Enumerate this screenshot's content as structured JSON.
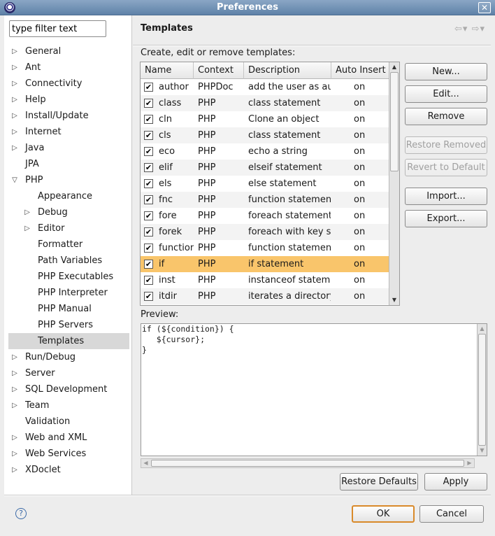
{
  "window": {
    "title": "Preferences",
    "close_glyph": "✕"
  },
  "filter": {
    "value": "type filter text"
  },
  "tree": [
    {
      "label": "General",
      "expander": "▷",
      "level": 0
    },
    {
      "label": "Ant",
      "expander": "▷",
      "level": 0
    },
    {
      "label": "Connectivity",
      "expander": "▷",
      "level": 0
    },
    {
      "label": "Help",
      "expander": "▷",
      "level": 0
    },
    {
      "label": "Install/Update",
      "expander": "▷",
      "level": 0
    },
    {
      "label": "Internet",
      "expander": "▷",
      "level": 0
    },
    {
      "label": "Java",
      "expander": "▷",
      "level": 0
    },
    {
      "label": "JPA",
      "expander": "",
      "level": 0
    },
    {
      "label": "PHP",
      "expander": "▽",
      "level": 0
    },
    {
      "label": "Appearance",
      "expander": "",
      "level": 1
    },
    {
      "label": "Debug",
      "expander": "▷",
      "level": 1
    },
    {
      "label": "Editor",
      "expander": "▷",
      "level": 1
    },
    {
      "label": "Formatter",
      "expander": "",
      "level": 1
    },
    {
      "label": "Path Variables",
      "expander": "",
      "level": 1
    },
    {
      "label": "PHP Executables",
      "expander": "",
      "level": 1
    },
    {
      "label": "PHP Interpreter",
      "expander": "",
      "level": 1
    },
    {
      "label": "PHP Manual",
      "expander": "",
      "level": 1
    },
    {
      "label": "PHP Servers",
      "expander": "",
      "level": 1
    },
    {
      "label": "Templates",
      "expander": "",
      "level": 1,
      "selected": true
    },
    {
      "label": "Run/Debug",
      "expander": "▷",
      "level": 0
    },
    {
      "label": "Server",
      "expander": "▷",
      "level": 0
    },
    {
      "label": "SQL Development",
      "expander": "▷",
      "level": 0
    },
    {
      "label": "Team",
      "expander": "▷",
      "level": 0
    },
    {
      "label": "Validation",
      "expander": "",
      "level": 0
    },
    {
      "label": "Web and XML",
      "expander": "▷",
      "level": 0
    },
    {
      "label": "Web Services",
      "expander": "▷",
      "level": 0
    },
    {
      "label": "XDoclet",
      "expander": "▷",
      "level": 0
    }
  ],
  "page": {
    "title": "Templates",
    "nav": "⇦▾ ⇨▾",
    "description": "Create, edit or remove templates:",
    "preview_label": "Preview:"
  },
  "table": {
    "columns": [
      "Name",
      "Context",
      "Description",
      "Auto Insert"
    ],
    "rows": [
      {
        "checked": true,
        "name": "author",
        "context": "PHPDoc",
        "description": "add the user as author",
        "auto": "on"
      },
      {
        "checked": true,
        "name": "class",
        "context": "PHP",
        "description": "class statement",
        "auto": "on"
      },
      {
        "checked": true,
        "name": "cln",
        "context": "PHP",
        "description": "Clone an object",
        "auto": "on"
      },
      {
        "checked": true,
        "name": "cls",
        "context": "PHP",
        "description": "class statement",
        "auto": "on"
      },
      {
        "checked": true,
        "name": "eco",
        "context": "PHP",
        "description": "echo a string",
        "auto": "on"
      },
      {
        "checked": true,
        "name": "elif",
        "context": "PHP",
        "description": "elseif statement",
        "auto": "on"
      },
      {
        "checked": true,
        "name": "els",
        "context": "PHP",
        "description": "else statement",
        "auto": "on"
      },
      {
        "checked": true,
        "name": "fnc",
        "context": "PHP",
        "description": "function statement",
        "auto": "on"
      },
      {
        "checked": true,
        "name": "fore",
        "context": "PHP",
        "description": "foreach statement",
        "auto": "on"
      },
      {
        "checked": true,
        "name": "forek",
        "context": "PHP",
        "description": "foreach with key statement",
        "auto": "on"
      },
      {
        "checked": true,
        "name": "function",
        "context": "PHP",
        "description": "function statement",
        "auto": "on"
      },
      {
        "checked": true,
        "name": "if",
        "context": "PHP",
        "description": "if statement",
        "auto": "on",
        "selected": true
      },
      {
        "checked": true,
        "name": "inst",
        "context": "PHP",
        "description": "instanceof statement",
        "auto": "on"
      },
      {
        "checked": true,
        "name": "itdir",
        "context": "PHP",
        "description": "iterates a directory",
        "auto": "on"
      }
    ]
  },
  "buttons": {
    "new": "New...",
    "edit": "Edit...",
    "remove": "Remove",
    "restore_removed": "Restore Removed",
    "revert_default": "Revert to Default",
    "import": "Import...",
    "export": "Export...",
    "restore_defaults": "Restore Defaults",
    "apply": "Apply",
    "ok": "OK",
    "cancel": "Cancel"
  },
  "preview": {
    "code": "if (${condition}) {\n   ${cursor};\n}"
  },
  "icons": {
    "help": "?",
    "check": "✔",
    "up": "▲",
    "down": "▼",
    "left": "◀",
    "right": "▶"
  },
  "colors": {
    "selection": "#f9c56b",
    "titlebar": "#6f8fb4",
    "default_button_border": "#d98a2a"
  }
}
